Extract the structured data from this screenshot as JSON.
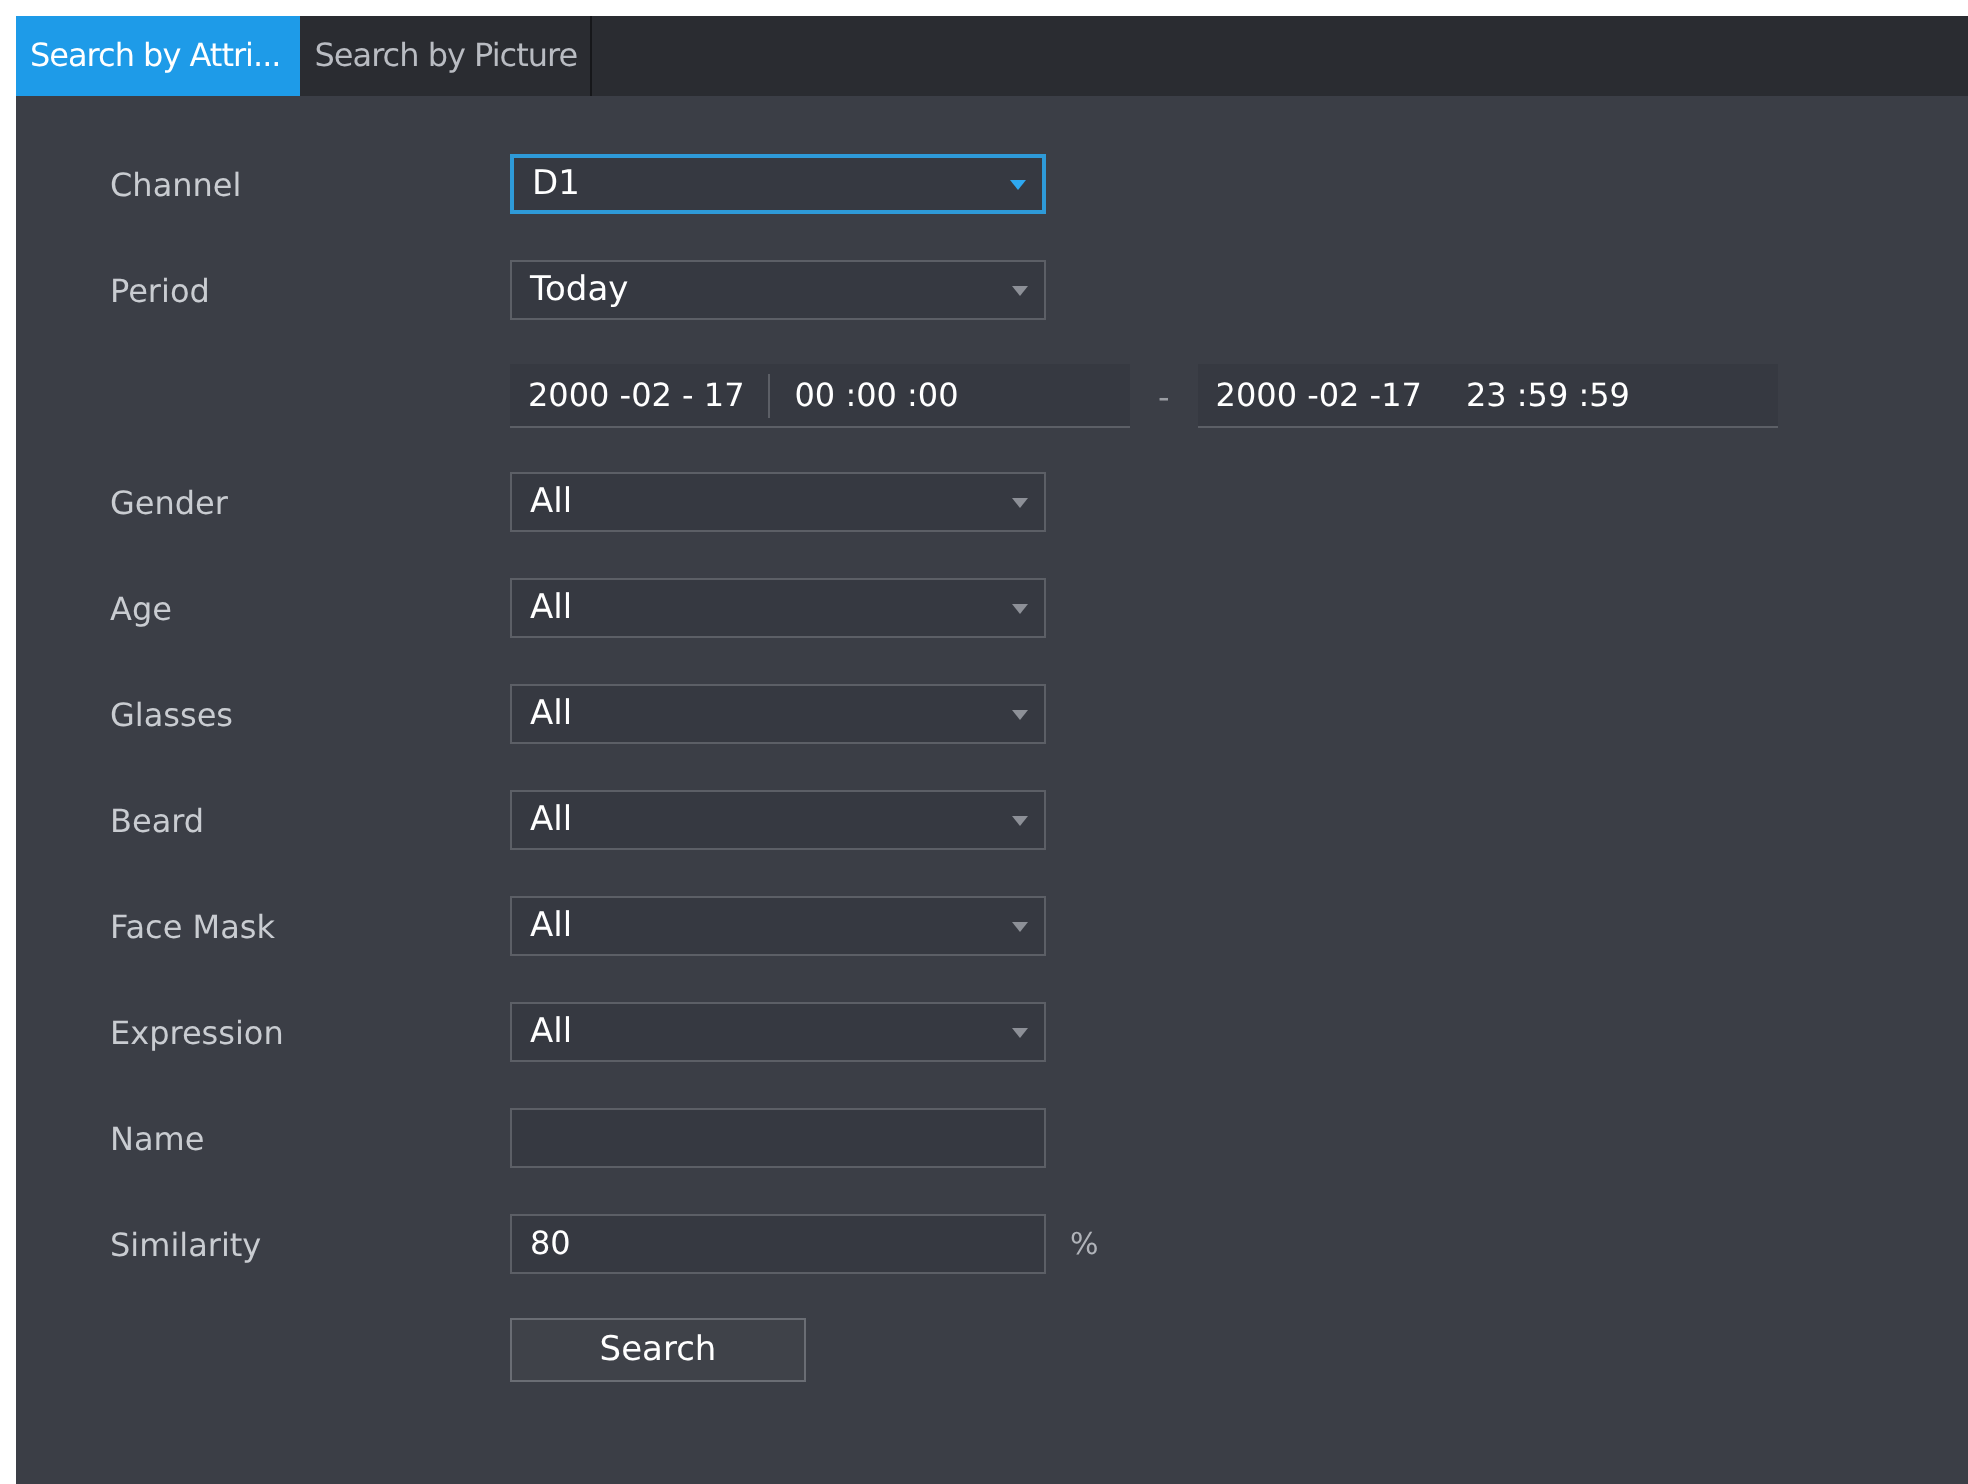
{
  "tabs": [
    {
      "label": "Search by Attri...",
      "selected": true
    },
    {
      "label": "Search by Picture",
      "selected": false
    }
  ],
  "form": [
    {
      "kind": "dropdown",
      "label": "Channel",
      "value": "D1",
      "focused": true
    },
    {
      "kind": "dropdown",
      "label": "Period",
      "value": "Today",
      "focused": false
    },
    {
      "kind": "daterange",
      "start_date": "2000 -02 - 17",
      "start_time": "00 :00 :00",
      "separator": "-",
      "end_date": "2000 -02 -17",
      "end_time": "23 :59 :59"
    },
    {
      "kind": "dropdown",
      "label": "Gender",
      "value": "All",
      "focused": false
    },
    {
      "kind": "dropdown",
      "label": "Age",
      "value": "All",
      "focused": false
    },
    {
      "kind": "dropdown",
      "label": "Glasses",
      "value": "All",
      "focused": false
    },
    {
      "kind": "dropdown",
      "label": "Beard",
      "value": "All",
      "focused": false
    },
    {
      "kind": "dropdown",
      "label": "Face Mask",
      "value": "All",
      "focused": false
    },
    {
      "kind": "dropdown",
      "label": "Expression",
      "value": "All",
      "focused": false
    },
    {
      "kind": "text",
      "label": "Name"
    },
    {
      "kind": "text",
      "label": "Similarity",
      "value": "80",
      "unit": "%"
    },
    {
      "kind": "button",
      "label": "Search"
    }
  ]
}
